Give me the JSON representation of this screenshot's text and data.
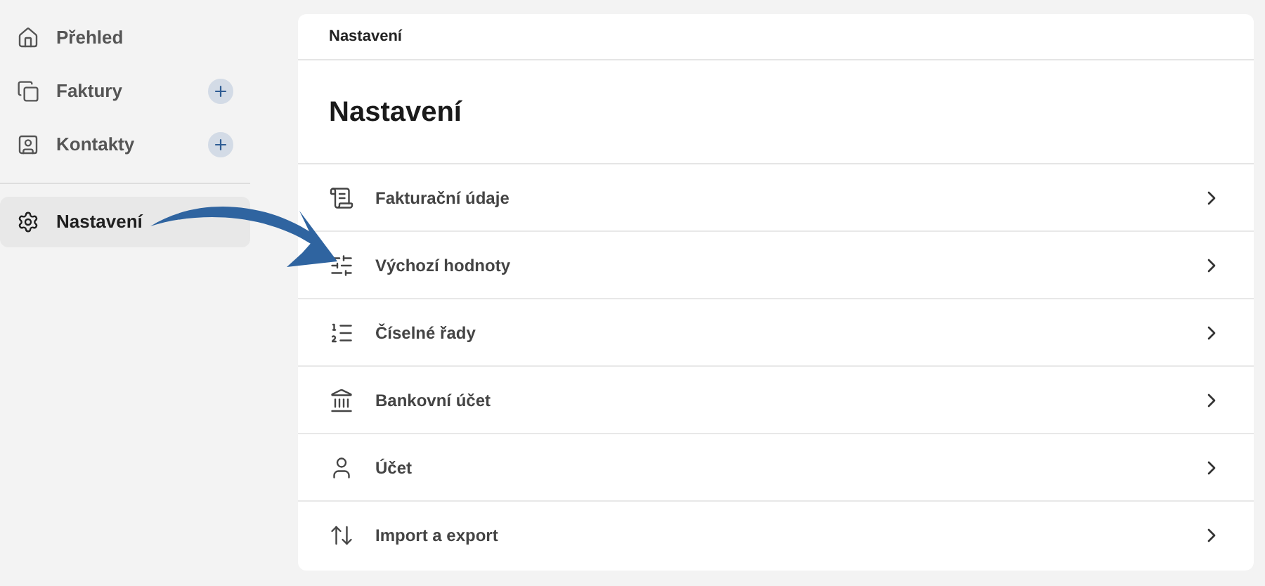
{
  "sidebar": {
    "items": [
      {
        "label": "Přehled",
        "selected": false,
        "add_button": false
      },
      {
        "label": "Faktury",
        "selected": false,
        "add_button": true
      },
      {
        "label": "Kontakty",
        "selected": false,
        "add_button": true
      }
    ],
    "bottom_items": [
      {
        "label": "Nastavení",
        "selected": true,
        "add_button": false
      }
    ]
  },
  "main": {
    "breadcrumb": "Nastavení",
    "title": "Nastavení",
    "rows": [
      {
        "label": "Fakturační údaje"
      },
      {
        "label": "Výchozí hodnoty"
      },
      {
        "label": "Číselné řady"
      },
      {
        "label": "Bankovní účet"
      },
      {
        "label": "Účet"
      },
      {
        "label": "Import a export"
      }
    ]
  }
}
